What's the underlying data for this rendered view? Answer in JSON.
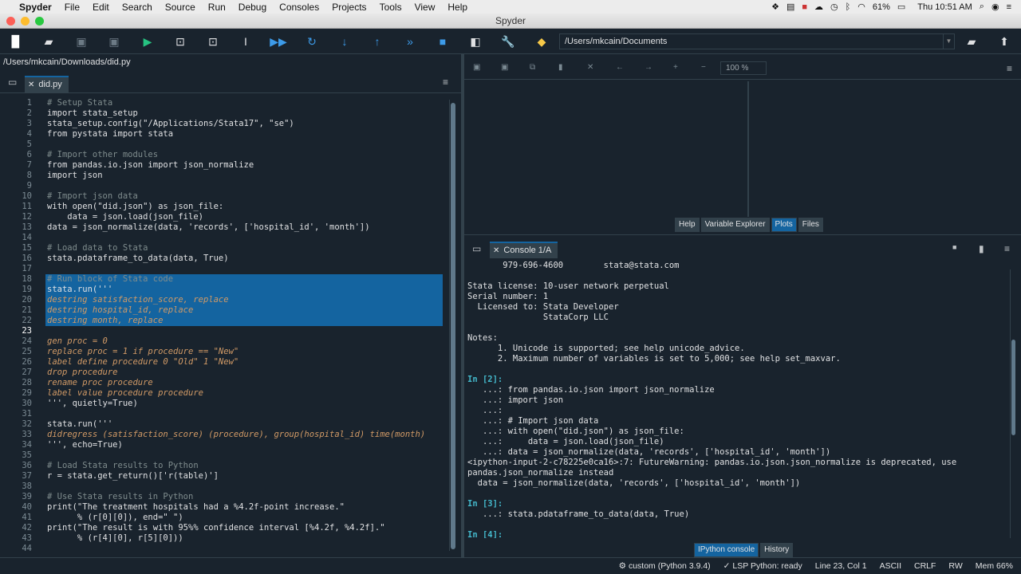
{
  "menubar": {
    "apple_icon": "apple-icon",
    "app_name": "Spyder",
    "items": [
      "File",
      "Edit",
      "Search",
      "Source",
      "Run",
      "Debug",
      "Consoles",
      "Projects",
      "Tools",
      "View",
      "Help"
    ],
    "battery": "61%",
    "clock": "Thu 10:51 AM"
  },
  "window": {
    "title": "Spyder"
  },
  "toolbar": {
    "working_dir": "/Users/mkcain/Documents",
    "icons": [
      "new-file-icon",
      "open-file-icon",
      "save-icon",
      "save-all-icon",
      "run-icon",
      "run-cell-icon",
      "run-cell-advance-icon",
      "run-selection-icon",
      "debug-icon",
      "step-icon",
      "step-into-icon",
      "step-return-icon",
      "continue-icon",
      "stop-icon",
      "maximize-pane-icon",
      "preferences-icon",
      "python-path-icon"
    ]
  },
  "editor": {
    "file_path": "/Users/mkcain/Downloads/did.py",
    "tab_label": "did.py",
    "current_line": 23,
    "line_numbers": [
      "1",
      "2",
      "3",
      "4",
      "5",
      "6",
      "7",
      "8",
      "9",
      "10",
      "11",
      "12",
      "13",
      "14",
      "15",
      "16",
      "17",
      "18",
      "19",
      "20",
      "21",
      "22",
      "23",
      "24",
      "25",
      "26",
      "27",
      "28",
      "29",
      "30",
      "31",
      "32",
      "33",
      "34",
      "35",
      "36",
      "37",
      "38",
      "39",
      "40",
      "41",
      "42",
      "43",
      "44"
    ],
    "lines": [
      "# Setup Stata",
      "import stata_setup",
      "stata_setup.config(\"/Applications/Stata17\", \"se\")",
      "from pystata import stata",
      "",
      "# Import other modules",
      "from pandas.io.json import json_normalize",
      "import json",
      "",
      "# Import json data",
      "with open(\"did.json\") as json_file:",
      "    data = json.load(json_file)",
      "data = json_normalize(data, 'records', ['hospital_id', 'month'])",
      "",
      "# Load data to Stata",
      "stata.pdataframe_to_data(data, True)",
      "",
      "# Run block of Stata code",
      "stata.run('''",
      "destring satisfaction_score, replace",
      "destring hospital_id, replace",
      "destring month, replace",
      "",
      "gen proc = 0",
      "replace proc = 1 if procedure == \"New\"",
      "label define procedure 0 \"Old\" 1 \"New\"",
      "drop procedure",
      "rename proc procedure",
      "label value procedure procedure",
      "''', quietly=True)",
      "",
      "stata.run('''",
      "didregress (satisfaction_score) (procedure), group(hospital_id) time(month)",
      "''', echo=True)",
      "",
      "# Load Stata results to Python",
      "r = stata.get_return()['r(table)']",
      "",
      "# Use Stata results in Python",
      "print(\"The treatment hospitals had a %4.2f-point increase.\"",
      "      % (r[0][0]), end=\" \")",
      "print(\"The result is with 95%% confidence interval [%4.2f, %4.2f].\"",
      "      % (r[4][0], r[5][0]))",
      ""
    ]
  },
  "plots_pane": {
    "zoom": "100 %",
    "tabs": [
      "Help",
      "Variable Explorer",
      "Plots",
      "Files"
    ],
    "active_tab": "Plots"
  },
  "console": {
    "tab_label": "Console 1/A",
    "lines": [
      "       979-696-4600        stata@stata.com",
      "",
      "Stata license: 10-user network perpetual",
      "Serial number: 1",
      "  Licensed to: Stata Developer",
      "               StataCorp LLC",
      "",
      "Notes:",
      "      1. Unicode is supported; see help unicode_advice.",
      "      2. Maximum number of variables is set to 5,000; see help set_maxvar.",
      "",
      "In [2]:",
      "   ...: from pandas.io.json import json_normalize",
      "   ...: import json",
      "   ...:",
      "   ...: # Import json data",
      "   ...: with open(\"did.json\") as json_file:",
      "   ...:     data = json.load(json_file)",
      "   ...: data = json_normalize(data, 'records', ['hospital_id', 'month'])",
      "<ipython-input-2-c78225e0ca16>:7: FutureWarning: pandas.io.json.json_normalize is deprecated, use",
      "pandas.json_normalize instead",
      "  data = json_normalize(data, 'records', ['hospital_id', 'month'])",
      "",
      "In [3]:",
      "   ...: stata.pdataframe_to_data(data, True)",
      "",
      "In [4]:"
    ],
    "bottom_tabs": [
      "IPython console",
      "History"
    ],
    "active_bottom_tab": "IPython console"
  },
  "status": {
    "env": "custom (Python 3.9.4)",
    "lsp": "LSP Python: ready",
    "position": "Line 23, Col 1",
    "encoding": "ASCII",
    "eol": "CRLF",
    "mode": "RW",
    "memory": "Mem 66%"
  }
}
